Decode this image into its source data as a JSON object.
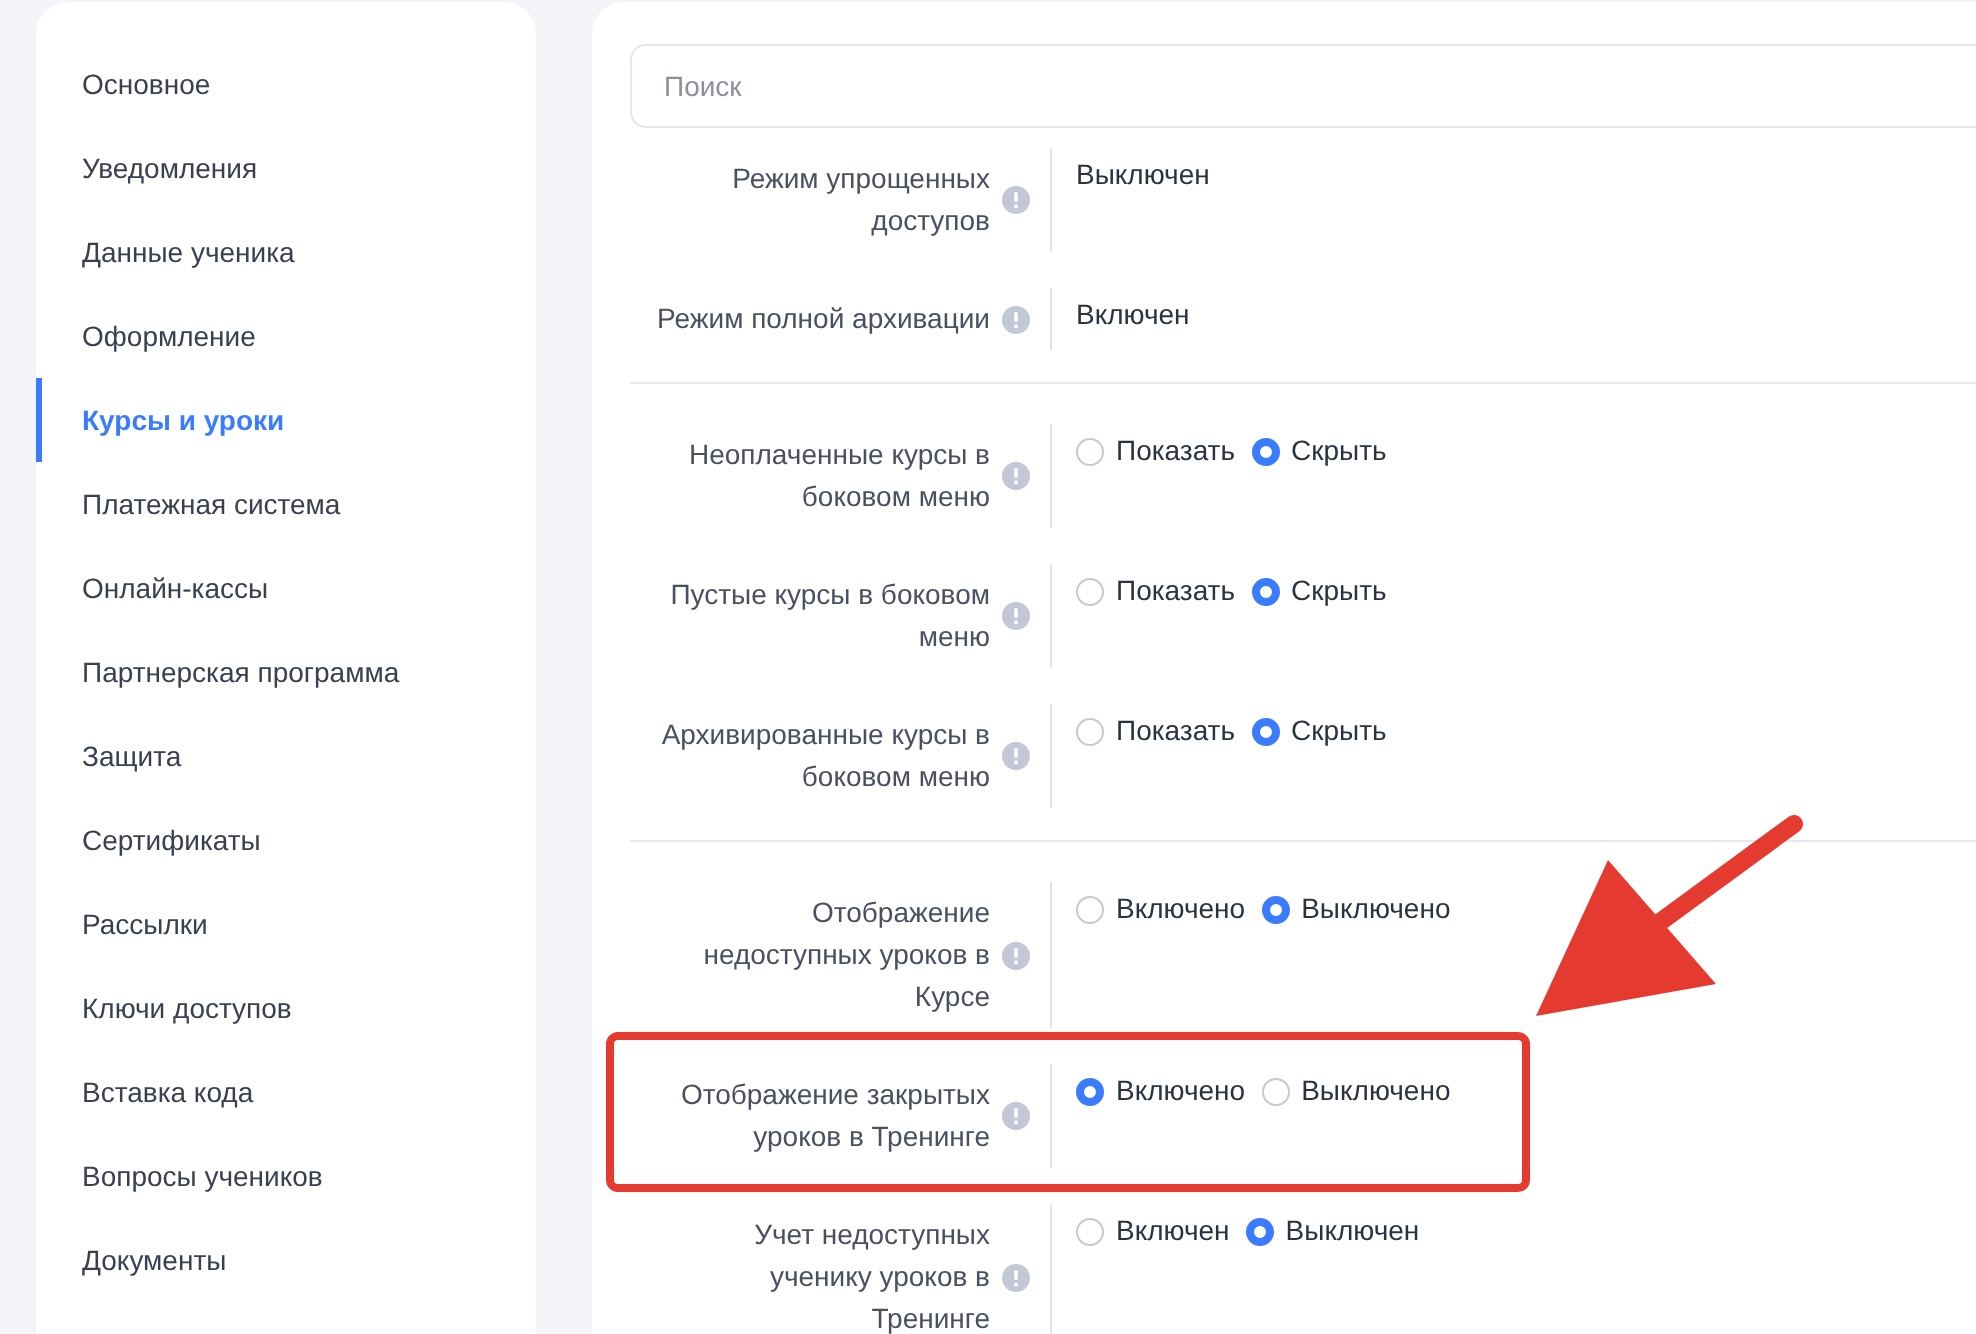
{
  "sidebar": {
    "items": [
      {
        "label": "Основное",
        "selected": false
      },
      {
        "label": "Уведомления",
        "selected": false
      },
      {
        "label": "Данные ученика",
        "selected": false
      },
      {
        "label": "Оформление",
        "selected": false
      },
      {
        "label": "Курсы и уроки",
        "selected": true
      },
      {
        "label": "Платежная система",
        "selected": false
      },
      {
        "label": "Онлайн-кассы",
        "selected": false
      },
      {
        "label": "Партнерская программа",
        "selected": false
      },
      {
        "label": "Защита",
        "selected": false
      },
      {
        "label": "Сертификаты",
        "selected": false
      },
      {
        "label": "Рассылки",
        "selected": false
      },
      {
        "label": "Ключи доступов",
        "selected": false
      },
      {
        "label": "Вставка кода",
        "selected": false
      },
      {
        "label": "Вопросы учеников",
        "selected": false
      },
      {
        "label": "Документы",
        "selected": false
      }
    ]
  },
  "search": {
    "placeholder": "Поиск"
  },
  "sections": [
    {
      "rows": [
        {
          "label": "Режим упрощенных доступов",
          "kind": "text",
          "value": "Выключен",
          "highlighted": false
        },
        {
          "label": "Режим полной архивации",
          "kind": "text",
          "value": "Включен",
          "highlighted": false
        }
      ]
    },
    {
      "rows": [
        {
          "label": "Неоплаченные курсы в боковом меню",
          "kind": "radio",
          "highlighted": false,
          "options": [
            {
              "label": "Показать",
              "selected": false
            },
            {
              "label": "Скрыть",
              "selected": true
            }
          ]
        },
        {
          "label": "Пустые курсы в боковом меню",
          "kind": "radio",
          "highlighted": false,
          "options": [
            {
              "label": "Показать",
              "selected": false
            },
            {
              "label": "Скрыть",
              "selected": true
            }
          ]
        },
        {
          "label": "Архивированные курсы в боковом меню",
          "kind": "radio",
          "highlighted": false,
          "options": [
            {
              "label": "Показать",
              "selected": false
            },
            {
              "label": "Скрыть",
              "selected": true
            }
          ]
        }
      ]
    },
    {
      "rows": [
        {
          "label": "Отображение недоступных уроков в Курсе",
          "kind": "radio",
          "highlighted": false,
          "options": [
            {
              "label": "Включено",
              "selected": false
            },
            {
              "label": "Выключено",
              "selected": true
            }
          ]
        },
        {
          "label": "Отображение закрытых уроков в Тренинге",
          "kind": "radio",
          "highlighted": true,
          "options": [
            {
              "label": "Включено",
              "selected": true
            },
            {
              "label": "Выключено",
              "selected": false
            }
          ]
        },
        {
          "label": "Учет недоступных ученику уроков в Тренинге",
          "kind": "radio",
          "highlighted": false,
          "options": [
            {
              "label": "Включен",
              "selected": false
            },
            {
              "label": "Выключен",
              "selected": true
            }
          ]
        }
      ]
    }
  ]
}
